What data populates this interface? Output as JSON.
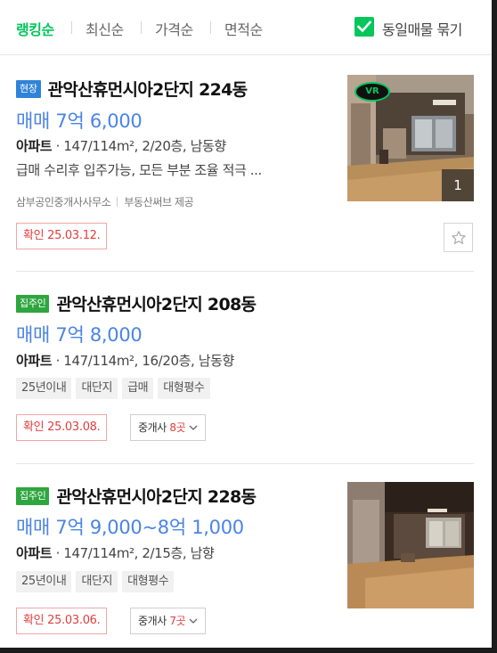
{
  "sort": {
    "tabs": [
      {
        "label": "랭킹순",
        "active": true
      },
      {
        "label": "최신순",
        "active": false
      },
      {
        "label": "가격순",
        "active": false
      },
      {
        "label": "면적순",
        "active": false
      }
    ],
    "group_label": "동일매물 묶기",
    "group_checked": true
  },
  "listings": [
    {
      "tag": "현장",
      "title": "관악산휴먼시아2단지 224동",
      "price": "매매 7억 6,000",
      "type": "아파트",
      "spec": "147/114m², 2/20층, 남동향",
      "desc": "급매 수리후 입주가능, 모든 부분 조율 적극 ...",
      "agent": "삼부공인중개사사무소",
      "provider": "부동산써브 제공",
      "confirmed": "확인 25.03.12.",
      "photo_count": "1",
      "vr_label": "VR"
    },
    {
      "tag": "집주인",
      "title": "관악산휴먼시아2단지 208동",
      "price": "매매 7억 8,000",
      "type": "아파트",
      "spec": "147/114m², 16/20층, 남동향",
      "chips": [
        "25년이내",
        "대단지",
        "급매",
        "대형평수"
      ],
      "confirmed": "확인 25.03.08.",
      "broker_label": "중개사",
      "broker_count": "8곳"
    },
    {
      "tag": "집주인",
      "title": "관악산휴먼시아2단지 228동",
      "price": "매매 7억 9,000~8억 1,000",
      "type": "아파트",
      "spec": "147/114m², 2/15층, 남향",
      "chips": [
        "25년이내",
        "대단지",
        "대형평수"
      ],
      "confirmed": "확인 25.03.06.",
      "broker_label": "중개사",
      "broker_count": "7곳"
    }
  ],
  "colors": {
    "accent": "#03c75a",
    "price": "#4a84e6",
    "confirm": "#e33d3d",
    "tag_blue": "#2f83d8",
    "tag_green": "#2ea63f"
  }
}
